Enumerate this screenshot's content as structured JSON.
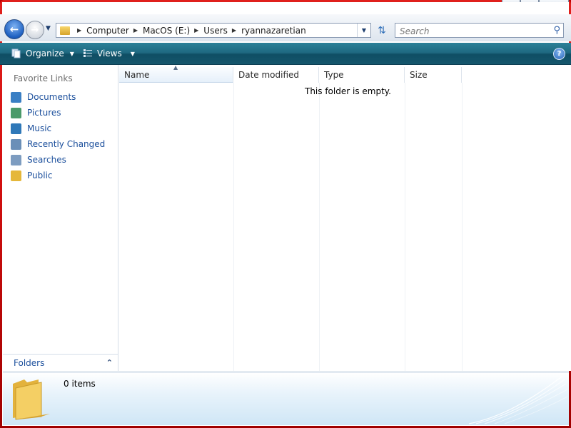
{
  "window": {
    "caption_buttons": {
      "minimize": "—",
      "maximize": "□",
      "close": "✕"
    },
    "frame_color": "#d41010"
  },
  "address_bar": {
    "breadcrumbs": [
      "Computer",
      "MacOS (E:)",
      "Users",
      "ryannazaretian"
    ]
  },
  "search": {
    "placeholder": "Search"
  },
  "toolbar": {
    "organize_label": "Organize",
    "views_label": "Views",
    "help_label": "?"
  },
  "nav_pane": {
    "favorites_header": "Favorite Links",
    "items": [
      {
        "label": "Documents",
        "icon": "documents-icon",
        "color": "#3a7fc4"
      },
      {
        "label": "Pictures",
        "icon": "pictures-icon",
        "color": "#4a9a6a"
      },
      {
        "label": "Music",
        "icon": "music-icon",
        "color": "#2f78b8"
      },
      {
        "label": "Recently Changed",
        "icon": "recently-changed-icon",
        "color": "#6a8fb8"
      },
      {
        "label": "Searches",
        "icon": "searches-icon",
        "color": "#7d9cc0"
      },
      {
        "label": "Public",
        "icon": "public-folder-icon",
        "color": "#e5b73a"
      }
    ],
    "folders_label": "Folders"
  },
  "file_list": {
    "columns": [
      "Name",
      "Date modified",
      "Type",
      "Size"
    ],
    "empty_message": "This folder is empty."
  },
  "details_pane": {
    "item_count": "0 items"
  }
}
